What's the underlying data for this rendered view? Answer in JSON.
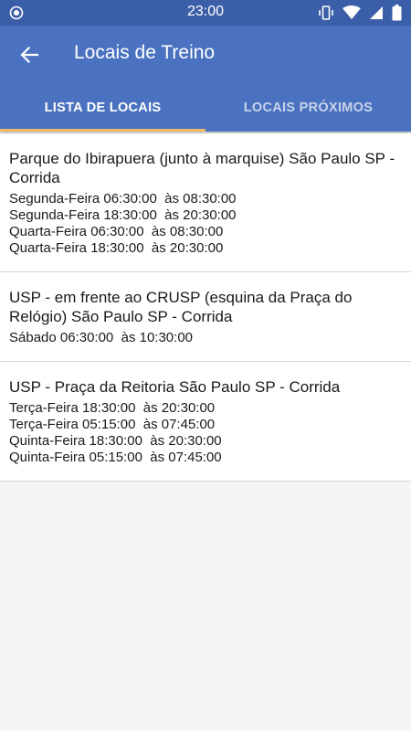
{
  "status_bar": {
    "time": "23:00",
    "left_icon": "record-icon",
    "right_icons": [
      "vibrate-icon",
      "wifi-icon",
      "signal-icon",
      "battery-icon"
    ]
  },
  "app_bar": {
    "title": "Locais de Treino",
    "back_icon": "arrow-back-icon"
  },
  "tabs": [
    {
      "label": "LISTA DE LOCAIS",
      "active": true
    },
    {
      "label": "LOCAIS PRÓXIMOS",
      "active": false
    }
  ],
  "locations": [
    {
      "name": "Parque do Ibirapuera (junto à marquise) São Paulo SP - Corrida",
      "schedules": [
        "Segunda-Feira 06:30:00  às 08:30:00",
        "Segunda-Feira 18:30:00  às 20:30:00",
        "Quarta-Feira 06:30:00  às 08:30:00",
        "Quarta-Feira 18:30:00  às 20:30:00"
      ]
    },
    {
      "name": "USP - em frente ao CRUSP (esquina da Praça do Relógio) São Paulo SP - Corrida",
      "schedules": [
        "Sábado 06:30:00  às 10:30:00"
      ]
    },
    {
      "name": "USP - Praça da Reitoria São Paulo SP - Corrida",
      "schedules": [
        "Terça-Feira 18:30:00  às 20:30:00",
        "Terça-Feira 05:15:00  às 07:45:00",
        "Quinta-Feira 18:30:00  às 20:30:00",
        "Quinta-Feira 05:15:00  às 07:45:00"
      ]
    }
  ],
  "colors": {
    "status_bar": "#3a5ea7",
    "app_bar": "#4a72c0",
    "tab_indicator": "#f4b86a",
    "background": "#f5f5f5"
  }
}
